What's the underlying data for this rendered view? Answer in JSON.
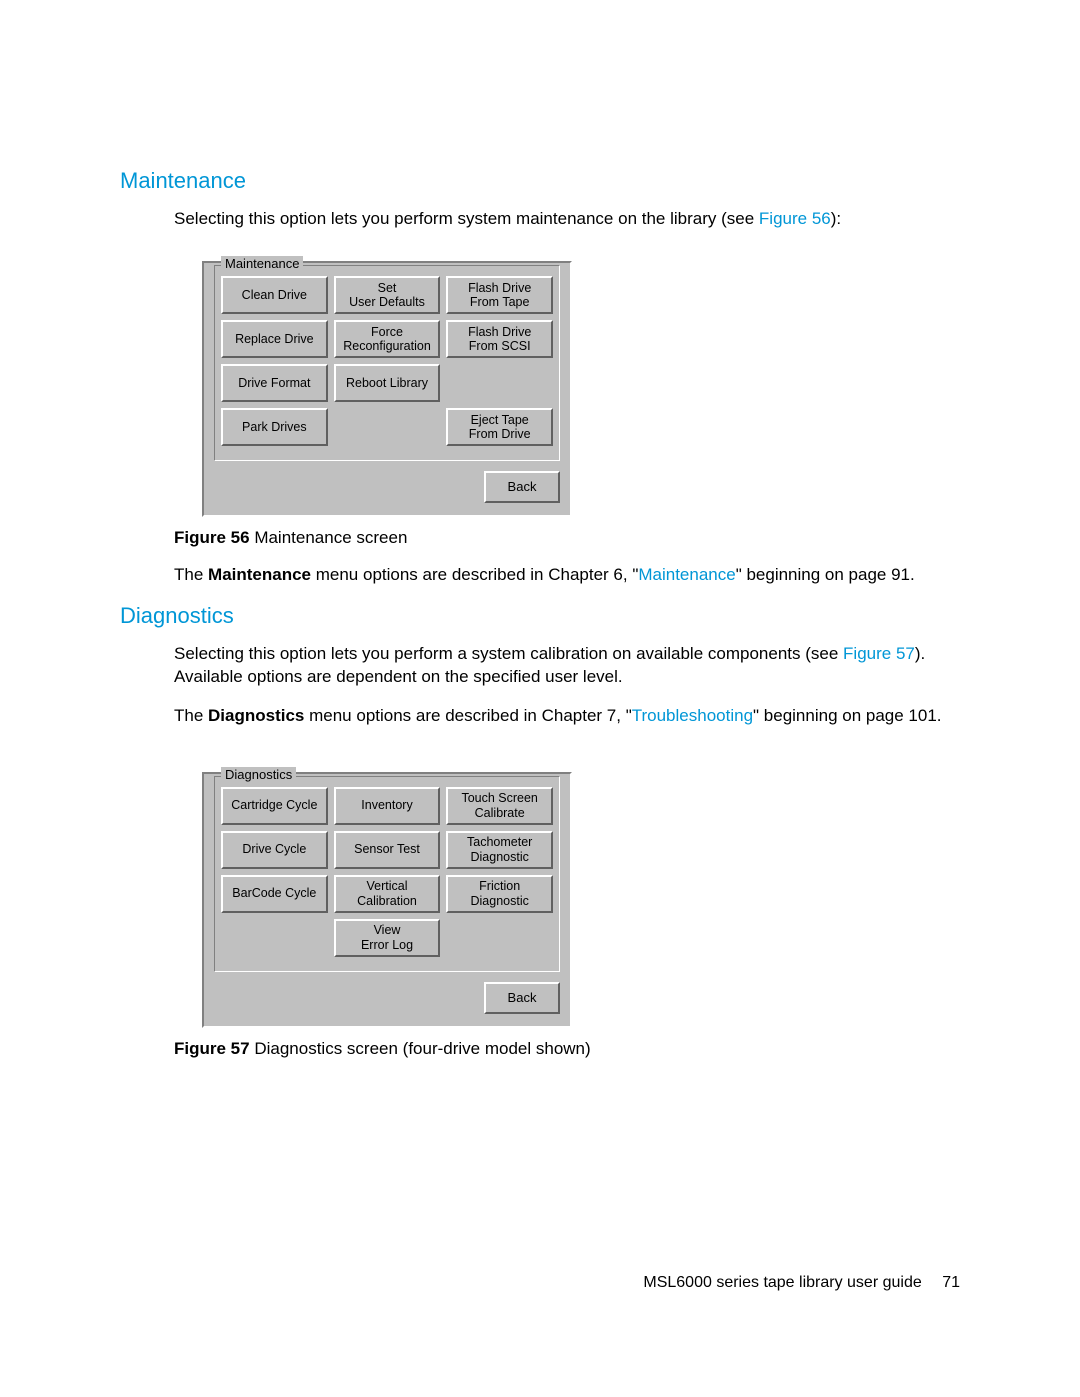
{
  "heading_maintenance": "Maintenance",
  "maint_intro_a": "Selecting this option lets you perform system maintenance on the library (see ",
  "maint_intro_ref": "Figure 56",
  "maint_intro_b": "):",
  "maint_panel": {
    "legend": "Maintenance",
    "rows": [
      [
        "Clean Drive",
        "Set\nUser Defaults",
        "Flash Drive\nFrom Tape"
      ],
      [
        "Replace Drive",
        "Force\nReconfiguration",
        "Flash Drive\nFrom SCSI"
      ],
      [
        "Drive Format",
        "Reboot Library",
        ""
      ],
      [
        "Park Drives",
        "",
        "Eject Tape\nFrom Drive"
      ]
    ],
    "back": "Back"
  },
  "fig56_label": "Figure 56",
  "fig56_caption": " Maintenance screen",
  "maint_desc_a": "The ",
  "maint_desc_b": "Maintenance",
  "maint_desc_c": " menu options are described in Chapter 6, \"",
  "maint_desc_link": "Maintenance",
  "maint_desc_d": "\" beginning on page 91.",
  "heading_diag": "Diagnostics",
  "diag_intro_a": "Selecting this option lets you perform a system calibration on available components (see ",
  "diag_intro_ref": "Figure 57",
  "diag_intro_b": "). Available options are dependent on the specified user level.",
  "diag_desc_a": "The ",
  "diag_desc_b": "Diagnostics",
  "diag_desc_c": " menu options are described in Chapter 7, \"",
  "diag_desc_link": "Troubleshooting",
  "diag_desc_d": "\" beginning on page 101.",
  "diag_panel": {
    "legend": "Diagnostics",
    "rows": [
      [
        "Cartridge Cycle",
        "Inventory",
        "Touch Screen\nCalibrate"
      ],
      [
        "Drive Cycle",
        "Sensor Test",
        "Tachometer\nDiagnostic"
      ],
      [
        "BarCode Cycle",
        "Vertical\nCalibration",
        "Friction\nDiagnostic"
      ],
      [
        "",
        "View\nError Log",
        ""
      ]
    ],
    "back": "Back"
  },
  "fig57_label": "Figure 57",
  "fig57_caption": " Diagnostics screen (four-drive model shown)",
  "footer_title": "MSL6000 series tape library user guide",
  "footer_page": "71"
}
